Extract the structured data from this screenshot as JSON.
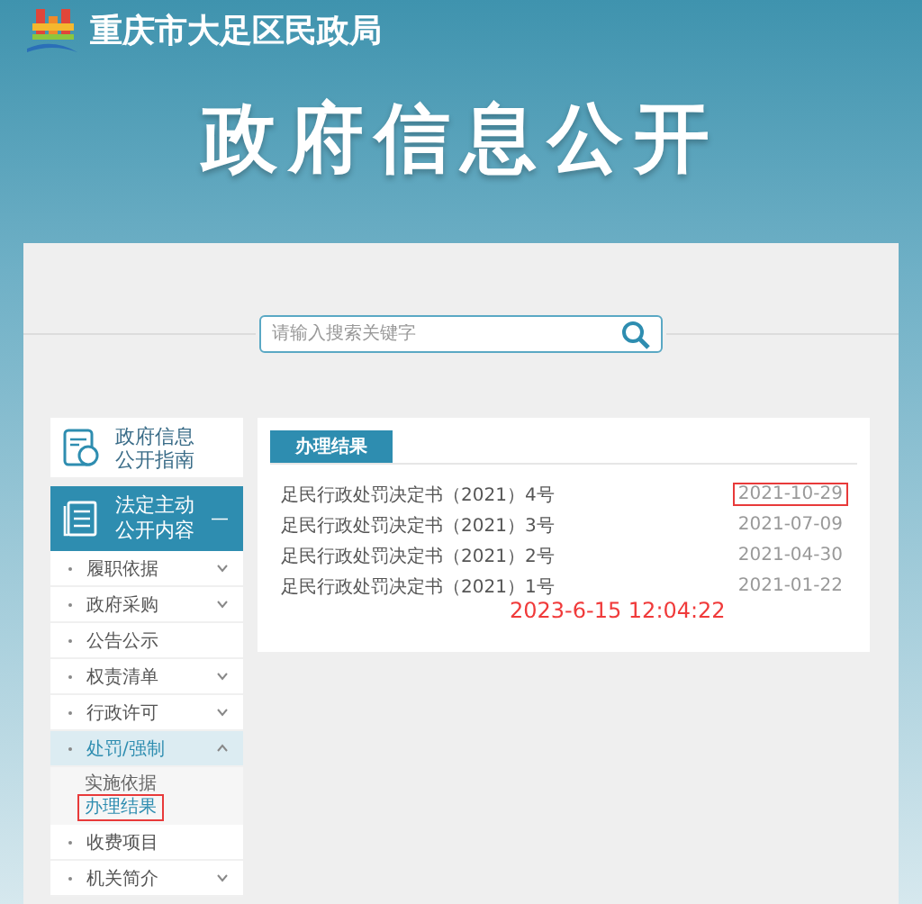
{
  "header": {
    "logo_text": "重庆市大足区民政局",
    "banner_title": "政府信息公开"
  },
  "search": {
    "placeholder": "请输入搜索关键字"
  },
  "sidebar": {
    "guide": {
      "label_lines": [
        "政府信息",
        "公开指南"
      ]
    },
    "section": {
      "label_lines": [
        "法定主动",
        "公开内容"
      ],
      "toggle": "—",
      "selected": true
    },
    "items": [
      {
        "label": "履职依据",
        "kind": "group",
        "expanded": false,
        "selected": false
      },
      {
        "label": "政府采购",
        "kind": "group",
        "expanded": false,
        "selected": false
      },
      {
        "label": "公告公示",
        "kind": "link",
        "selected": false
      },
      {
        "label": "权责清单",
        "kind": "group",
        "expanded": false,
        "selected": false
      },
      {
        "label": "行政许可",
        "kind": "group",
        "expanded": false,
        "selected": false
      },
      {
        "label": "处罚/强制",
        "kind": "group",
        "expanded": true,
        "selected": true,
        "children": [
          {
            "label": "实施依据",
            "selected": false,
            "highlighted": false
          },
          {
            "label": "办理结果",
            "selected": true,
            "highlighted": true
          }
        ]
      },
      {
        "label": "收费项目",
        "kind": "link",
        "selected": false
      },
      {
        "label": "机关简介",
        "kind": "group",
        "expanded": false,
        "selected": false
      }
    ]
  },
  "content": {
    "tabs": [
      {
        "label": "办理结果",
        "selected": true
      }
    ],
    "rows": [
      {
        "title": "足民行政处罚决定书（2021）4号",
        "date": "2021-10-29",
        "highlighted": true
      },
      {
        "title": "足民行政处罚决定书（2021）3号",
        "date": "2021-07-09",
        "highlighted": false
      },
      {
        "title": "足民行政处罚决定书（2021）2号",
        "date": "2021-04-30",
        "highlighted": false
      },
      {
        "title": "足民行政处罚决定书（2021）1号",
        "date": "2021-01-22",
        "highlighted": false
      }
    ],
    "timestamp_annotation": "2023-6-15 12:04:22"
  }
}
